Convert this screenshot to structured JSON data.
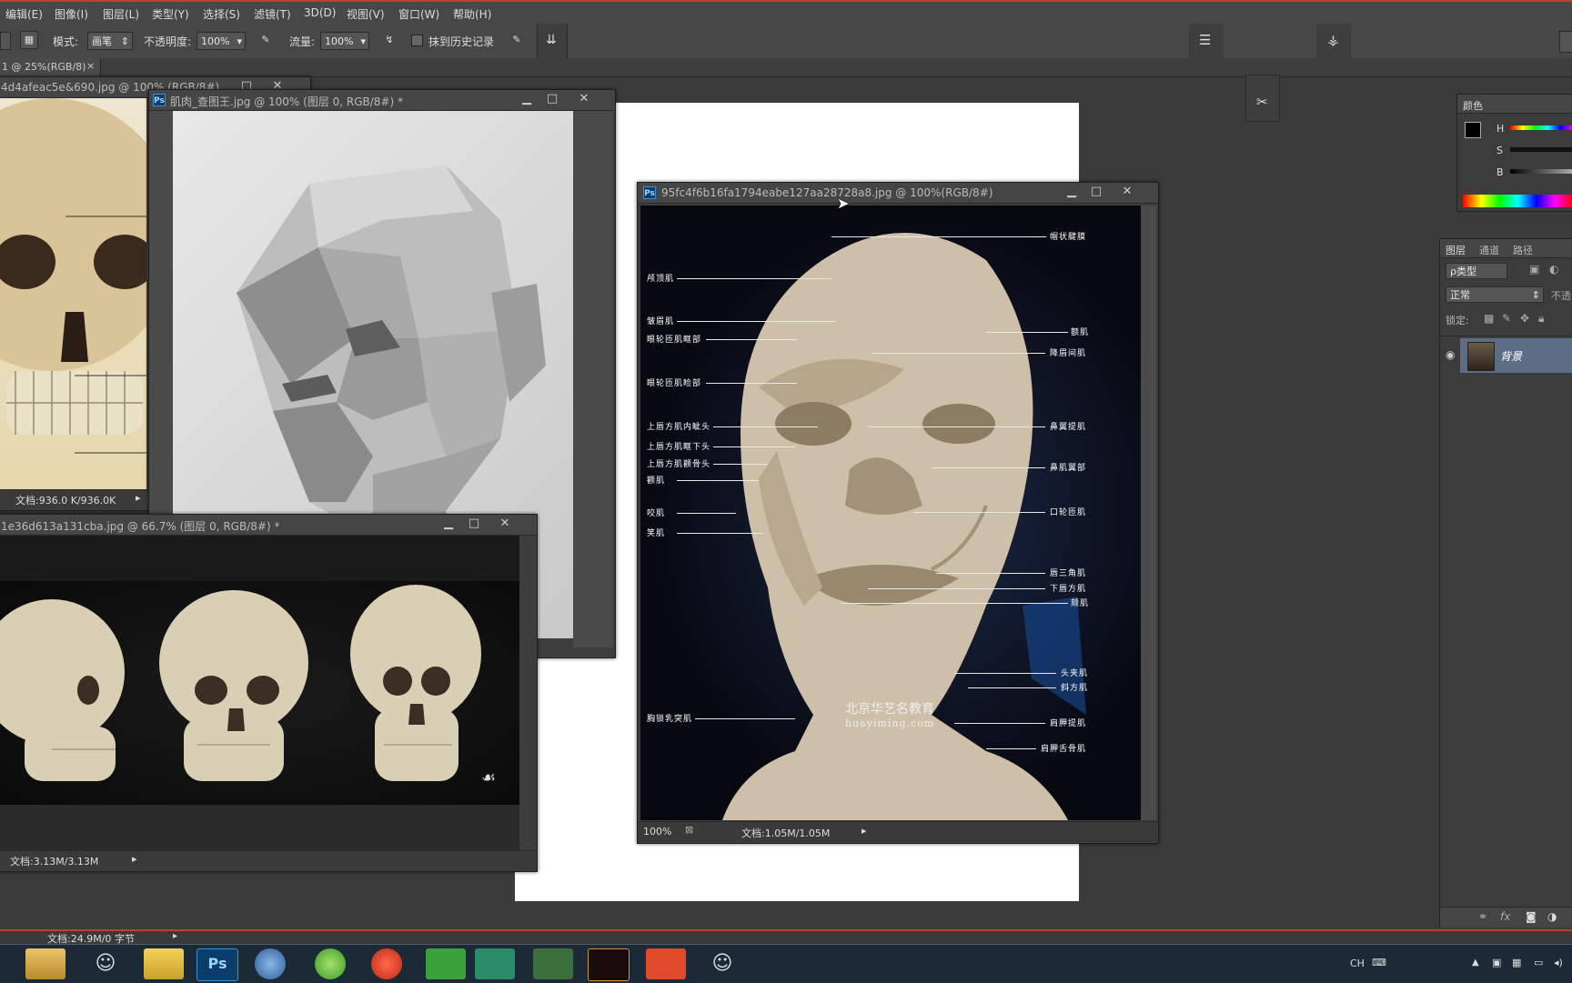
{
  "menu": [
    "编辑(E)",
    "图像(I)",
    "图层(L)",
    "类型(Y)",
    "选择(S)",
    "滤镜(T)",
    "3D(D)",
    "视图(V)",
    "窗口(W)",
    "帮助(H)"
  ],
  "options": {
    "mode_label": "模式:",
    "mode_value": "画笔",
    "opacity_label": "不透明度:",
    "opacity_value": "100%",
    "flow_label": "流量:",
    "flow_value": "100%",
    "history_label": "抹到历史记录"
  },
  "tab": {
    "label": "1 @ 25%(RGB/8)",
    "close": "×"
  },
  "windows": {
    "skull_front": {
      "title": "4d4afeac5e&690.jpg @ 100% (RGB/8#)",
      "status": "文档:936.0 K/936.0K"
    },
    "planar_head": {
      "title": "肌肉_查图王.jpg @ 100% (图层 0, RGB/8#) *"
    },
    "skulls_row": {
      "title": "1e36d613a131cba.jpg @ 66.7% (图层 0, RGB/8#) *",
      "status": "文档:3.13M/3.13M"
    },
    "muscle_head": {
      "title": "95fc4f6b16fa1794eabe127aa28728a8.jpg @ 100%(RGB/8#)",
      "zoom": "100%",
      "status": "文档:1.05M/1.05M"
    }
  },
  "annotations_left": [
    "颅顶肌",
    "皱眉肌",
    "眼轮匝肌眶部",
    "眼轮匝肌睑部",
    "上唇方肌内眦头",
    "上唇方肌眶下头",
    "上唇方肌颧骨头",
    "颧肌",
    "咬肌",
    "笑肌",
    "胸锁乳突肌"
  ],
  "annotations_right": [
    "帽状腱膜",
    "额肌",
    "降眉间肌",
    "鼻翼提肌",
    "鼻肌翼部",
    "口轮匝肌",
    "唇三角肌",
    "下唇方肌",
    "颏肌",
    "头夹肌",
    "斜方肌",
    "肩胛提肌",
    "肩胛舌骨肌"
  ],
  "watermark": {
    "line1": "北京华艺名教育",
    "line2": "huayiming.com"
  },
  "panels": {
    "color": {
      "tab": "颜色",
      "h": "H",
      "s": "S",
      "b": "B"
    },
    "layers": {
      "tabs": [
        "图层",
        "通道",
        "路径"
      ],
      "filter": "ρ类型",
      "blend": "正常",
      "opacity": "不透",
      "lock": "锁定:",
      "layer_name": "背景"
    }
  },
  "main_status": "文档:24.9M/0 字节",
  "taskbar": {
    "lang": "CH"
  },
  "colors": {
    "accent": "#c23a3a",
    "bg": "#3b3b3b",
    "panel": "#474747"
  }
}
